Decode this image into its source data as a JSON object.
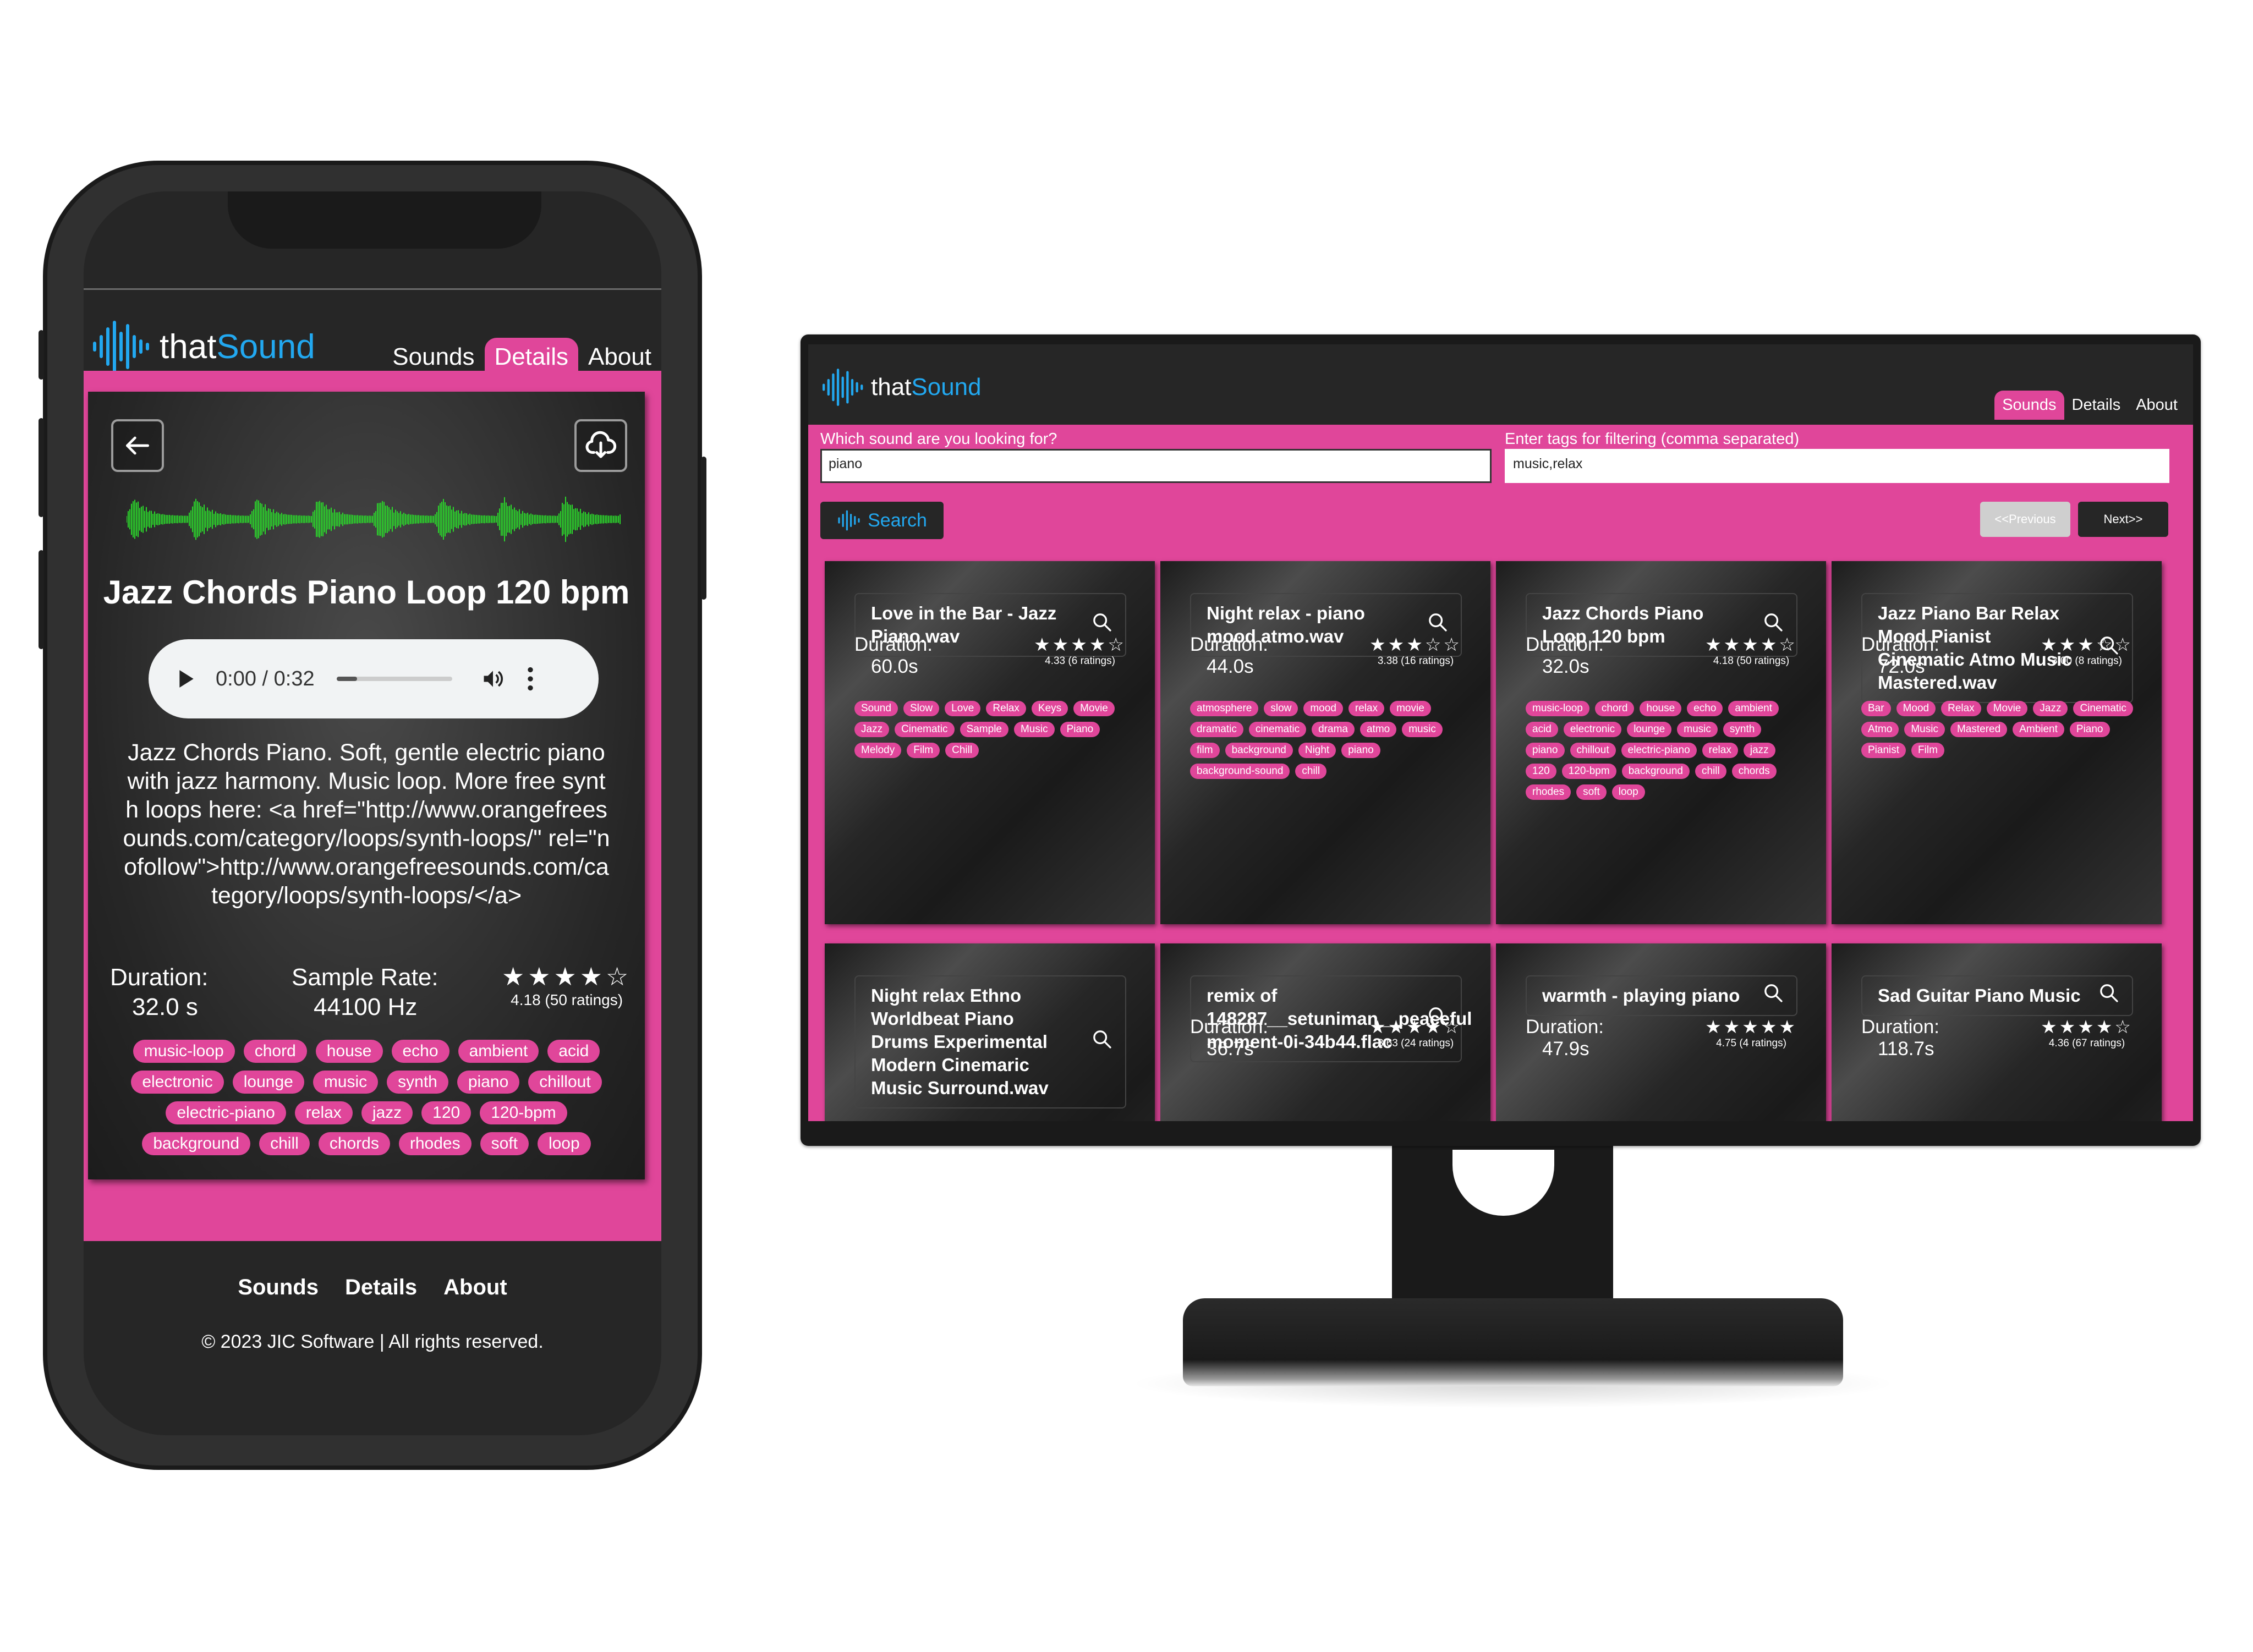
{
  "brand": {
    "that": "that",
    "sound": "Sound"
  },
  "colors": {
    "accent": "#e0469a",
    "brand_blue": "#22a8f0",
    "background": "#262626",
    "waveform": "#2bd62b"
  },
  "phone": {
    "nav": {
      "sounds": "Sounds",
      "details": "Details",
      "about": "About",
      "active": "Details"
    },
    "icons": {
      "back": "arrow-left-icon",
      "download": "cloud-download-icon"
    },
    "title": "Jazz Chords Piano Loop 120 bpm",
    "player": {
      "time": "0:00 / 0:32",
      "progress_fraction": 0.18
    },
    "description": "Jazz Chords Piano. Soft, gentle electric piano with jazz harmony. Music loop. More free synth loops here: <a href=\"http://www.orangefreesounds.com/category/loops/synth-loops/\" rel=\"nofollow\">http://www.orangefreesounds.com/category/loops/synth-loops/</a>",
    "duration_label": "Duration:",
    "duration_value": "32.0 s",
    "samplerate_label": "Sample Rate:",
    "samplerate_value": "44100 Hz",
    "stars": 4,
    "rating_text": "4.18 (50 ratings)",
    "tags": [
      "music-loop",
      "chord",
      "house",
      "echo",
      "ambient",
      "acid",
      "electronic",
      "lounge",
      "music",
      "synth",
      "piano",
      "chillout",
      "electric-piano",
      "relax",
      "jazz",
      "120",
      "120-bpm",
      "background",
      "chill",
      "chords",
      "rhodes",
      "soft",
      "loop"
    ],
    "footer": {
      "sounds": "Sounds",
      "details": "Details",
      "about": "About",
      "copyright": "© 2023 JIC Software | All rights reserved."
    }
  },
  "desktop": {
    "nav": {
      "sounds": "Sounds",
      "details": "Details",
      "about": "About",
      "active": "Sounds"
    },
    "search_label": "Which sound are you looking for?",
    "search_value": "piano",
    "tags_label": "Enter tags for filtering (comma separated)",
    "tags_value": "music,relax",
    "search_button": "Search",
    "prev_button": "<<Previous",
    "next_button": "Next>>",
    "cards": [
      {
        "title": "Love in the Bar - Jazz Piano.wav",
        "duration_label": "Duration:",
        "duration": "60.0s",
        "stars": 4,
        "rating": "4.33 (6 ratings)",
        "tags": [
          "Sound",
          "Slow",
          "Love",
          "Relax",
          "Keys",
          "Movie",
          "Jazz",
          "Cinematic",
          "Sample",
          "Music",
          "Piano",
          "Melody",
          "Film",
          "Chill"
        ]
      },
      {
        "title": "Night relax - piano mood atmo.wav",
        "duration_label": "Duration:",
        "duration": "44.0s",
        "stars": 3,
        "rating": "3.38 (16 ratings)",
        "tags": [
          "atmosphere",
          "slow",
          "mood",
          "relax",
          "movie",
          "dramatic",
          "cinematic",
          "drama",
          "atmo",
          "music",
          "film",
          "background",
          "Night",
          "piano",
          "background-sound",
          "chill"
        ]
      },
      {
        "title": "Jazz Chords Piano Loop 120 bpm",
        "duration_label": "Duration:",
        "duration": "32.0s",
        "stars": 4,
        "rating": "4.18 (50 ratings)",
        "tags": [
          "music-loop",
          "chord",
          "house",
          "echo",
          "ambient",
          "acid",
          "electronic",
          "lounge",
          "music",
          "synth",
          "piano",
          "chillout",
          "electric-piano",
          "relax",
          "jazz",
          "120",
          "120-bpm",
          "background",
          "chill",
          "chords",
          "rhodes",
          "soft",
          "loop"
        ]
      },
      {
        "title": "Jazz Piano Bar Relax Mood Pianist Cinematic Atmo Music Mastered.wav",
        "duration_label": "Duration:",
        "duration": "72.0s",
        "stars": 3,
        "rating": "3.00 (8 ratings)",
        "tags": [
          "Bar",
          "Mood",
          "Relax",
          "Movie",
          "Jazz",
          "Cinematic",
          "Atmo",
          "Music",
          "Mastered",
          "Ambient",
          "Piano",
          "Pianist",
          "Film"
        ]
      },
      {
        "title": "Night relax Ethno Worldbeat Piano Drums Experimental Modern Cinemaric Music Surround.wav",
        "duration_label": "",
        "duration": "",
        "stars": 0,
        "rating": "",
        "tags": []
      },
      {
        "title": "remix of 148287__setuniman__peaceful moment-0i-34b44.flac",
        "duration_label": "Duration:",
        "duration": "36.7s",
        "stars": 4,
        "rating": "3.63 (24 ratings)",
        "tags": []
      },
      {
        "title": "warmth - playing piano",
        "duration_label": "Duration:",
        "duration": "47.9s",
        "stars": 5,
        "rating": "4.75 (4 ratings)",
        "tags": []
      },
      {
        "title": "Sad Guitar Piano Music",
        "duration_label": "Duration:",
        "duration": "118.7s",
        "stars": 4,
        "rating": "4.36 (67 ratings)",
        "tags": []
      }
    ]
  }
}
